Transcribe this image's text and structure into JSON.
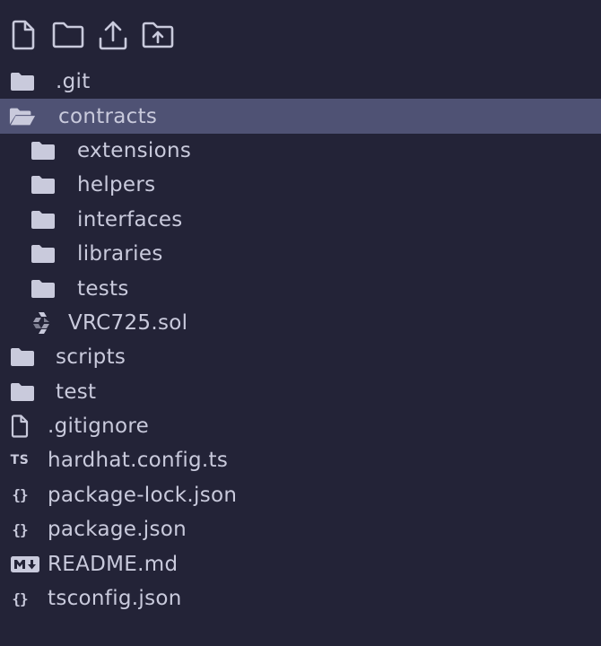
{
  "toolbar": {
    "buttons": [
      {
        "icon": "new-file-icon"
      },
      {
        "icon": "new-folder-icon"
      },
      {
        "icon": "upload-icon"
      },
      {
        "icon": "folder-upload-icon"
      }
    ]
  },
  "tree": {
    "items": [
      {
        "label": ".git",
        "icon": "folder-icon"
      },
      {
        "label": "contracts",
        "icon": "folder-open-icon",
        "selected": true
      },
      {
        "label": "extensions",
        "icon": "folder-icon"
      },
      {
        "label": "helpers",
        "icon": "folder-icon"
      },
      {
        "label": "interfaces",
        "icon": "folder-icon"
      },
      {
        "label": "libraries",
        "icon": "folder-icon"
      },
      {
        "label": "tests",
        "icon": "folder-icon"
      },
      {
        "label": "VRC725.sol",
        "icon": "solidity-icon"
      },
      {
        "label": "scripts",
        "icon": "folder-icon"
      },
      {
        "label": "test",
        "icon": "folder-icon"
      },
      {
        "label": ".gitignore",
        "icon": "file-icon"
      },
      {
        "label": "hardhat.config.ts",
        "icon": "typescript-icon",
        "icon_text": "TS"
      },
      {
        "label": "package-lock.json",
        "icon": "json-icon",
        "icon_text": "{}"
      },
      {
        "label": "package.json",
        "icon": "json-icon",
        "icon_text": "{}"
      },
      {
        "label": "README.md",
        "icon": "markdown-icon"
      },
      {
        "label": "tsconfig.json",
        "icon": "json-icon",
        "icon_text": "{}"
      }
    ]
  },
  "colors": {
    "background": "#232337",
    "selected_row": "#4f5274",
    "text": "#c9cadc",
    "icon": "#c9cadc"
  }
}
